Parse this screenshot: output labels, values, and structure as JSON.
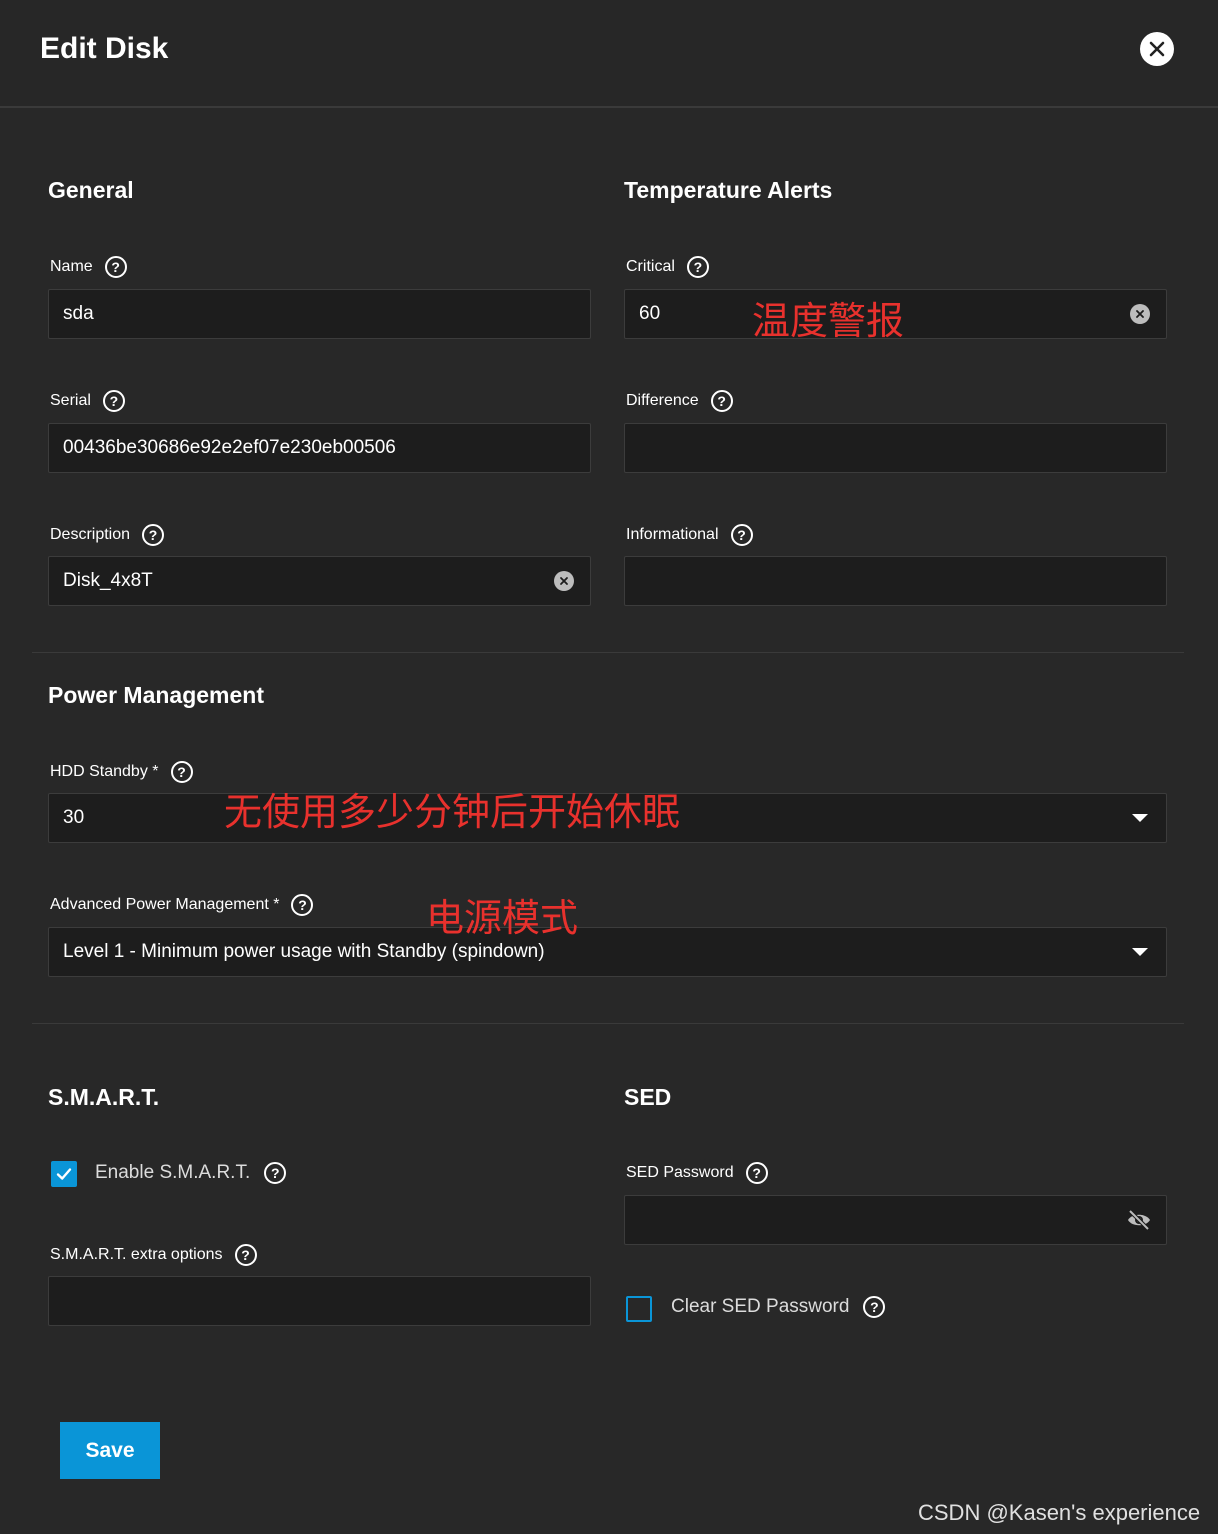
{
  "dialog": {
    "title": "Edit Disk"
  },
  "general": {
    "title": "General",
    "name": {
      "label": "Name",
      "value": "sda"
    },
    "serial": {
      "label": "Serial",
      "value": "00436be30686e92e2ef07e230eb00506"
    },
    "description": {
      "label": "Description",
      "value": "Disk_4x8T"
    }
  },
  "temperature": {
    "title": "Temperature Alerts",
    "critical": {
      "label": "Critical",
      "value": "60"
    },
    "difference": {
      "label": "Difference",
      "value": ""
    },
    "informational": {
      "label": "Informational",
      "value": ""
    }
  },
  "power": {
    "title": "Power Management",
    "hdd_standby": {
      "label": "HDD Standby *",
      "value": "30"
    },
    "apm": {
      "label": "Advanced Power Management *",
      "value": "Level 1 - Minimum power usage with Standby (spindown)"
    }
  },
  "smart": {
    "title": "S.M.A.R.T.",
    "enable": {
      "label": "Enable S.M.A.R.T.",
      "checked": true
    },
    "extra_options": {
      "label": "S.M.A.R.T. extra options",
      "value": ""
    }
  },
  "sed": {
    "title": "SED",
    "password": {
      "label": "SED Password",
      "value": ""
    },
    "clear": {
      "label": "Clear SED Password",
      "checked": false
    }
  },
  "annotations": {
    "temperature_alert": "温度警报",
    "standby_note": "无使用多少分钟后开始休眠",
    "power_mode": "电源模式"
  },
  "actions": {
    "save_label": "Save"
  },
  "watermark": "CSDN @Kasen's experience",
  "colors": {
    "accent": "#0a95d7",
    "background": "#282828",
    "input_bg": "#1d1d1d",
    "annotation": "#e8312d"
  }
}
